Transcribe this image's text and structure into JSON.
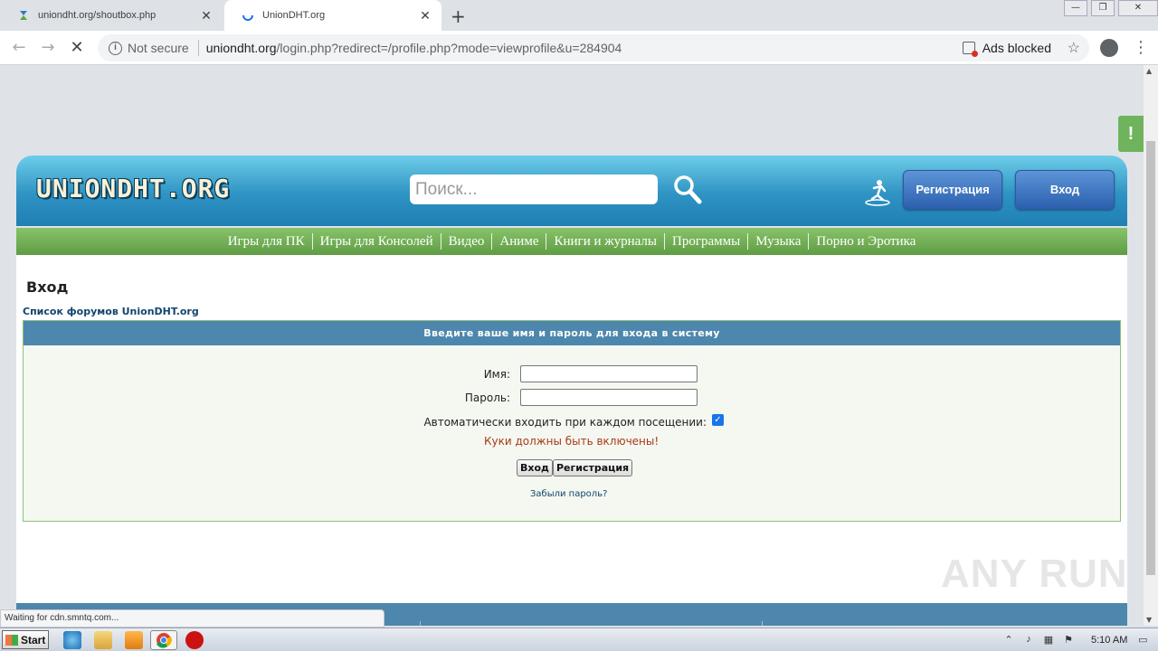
{
  "browser": {
    "tabs": [
      {
        "title": "uniondht.org/shoutbox.php",
        "active": false
      },
      {
        "title": "UnionDHT.org",
        "active": true
      }
    ],
    "address": {
      "security": "Not secure",
      "host": "uniondht.org",
      "path": "/login.php?redirect=/profile.php?mode=viewprofile&u=284904"
    },
    "ads_blocked": "Ads blocked",
    "status_text": "Waiting for cdn.smntq.com..."
  },
  "site": {
    "logo": "UNIONDHT.ORG",
    "search_placeholder": "Поиск...",
    "register_button": "Регистрация",
    "login_button": "Вход",
    "nav": [
      "Игры для ПК",
      "Игры для Консолей",
      "Видео",
      "Аниме",
      "Книги и журналы",
      "Программы",
      "Музыка",
      "Порно и Эротика"
    ],
    "alert_label": "!"
  },
  "login_page": {
    "title": "Вход",
    "breadcrumb": "Список форумов UnionDHT.org",
    "panel_header": "Введите ваше имя и пароль для входа в систему",
    "name_label": "Имя:",
    "password_label": "Пароль:",
    "autologin_label": "Автоматически входить при каждом посещении:",
    "autologin_checked": true,
    "cookie_warning": "Куки должны быть включены!",
    "submit_label": "Вход",
    "register_label": "Регистрация",
    "forgot_label": "Забыли пароль?"
  },
  "watermark": "ANY RUN",
  "taskbar": {
    "start_label": "Start",
    "clock": "5:10 AM"
  },
  "colors": {
    "header_blue": "#2f93c3",
    "nav_green": "#5f9c44",
    "panel_header": "#4d87ad",
    "warning": "#a83a1a"
  }
}
